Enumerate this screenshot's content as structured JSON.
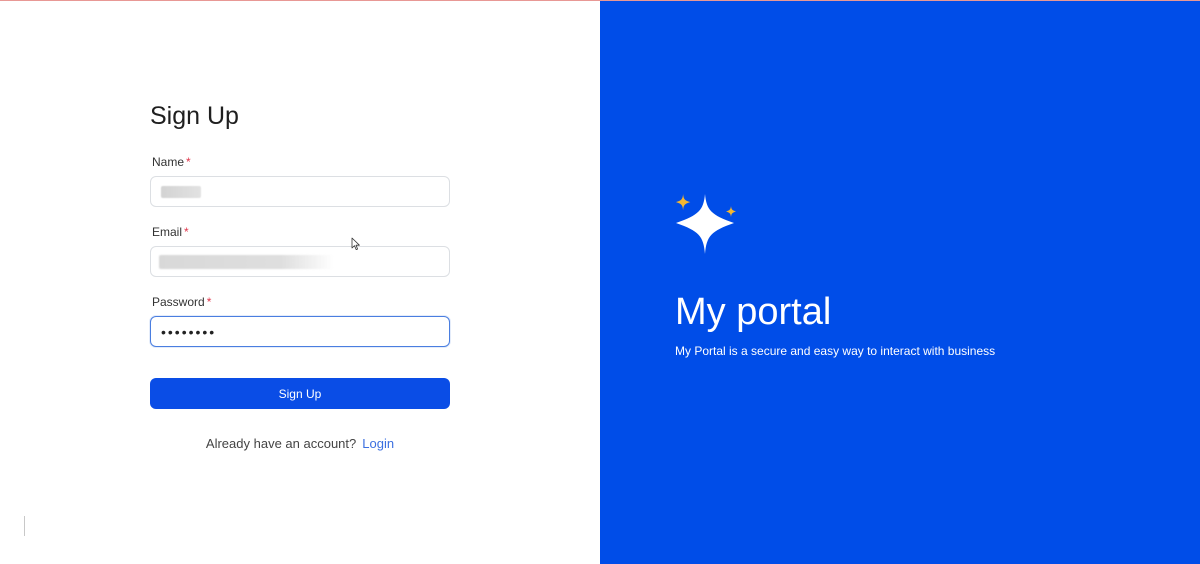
{
  "form": {
    "title": "Sign Up",
    "name_label": "Name",
    "email_label": "Email",
    "password_label": "Password",
    "required_mark": "*",
    "password_value": "••••••••",
    "submit_label": "Sign Up",
    "login_prompt": "Already have an account?",
    "login_link": "Login"
  },
  "brand": {
    "title": "My portal",
    "subtitle": "My Portal is a secure and easy way to interact with business",
    "icon": "sparkle-icon"
  },
  "colors": {
    "accent": "#0a4de6",
    "panel": "#004de8",
    "required": "#e0364b",
    "link": "#3b6fe0",
    "sparkle_small": "#f5b731"
  }
}
